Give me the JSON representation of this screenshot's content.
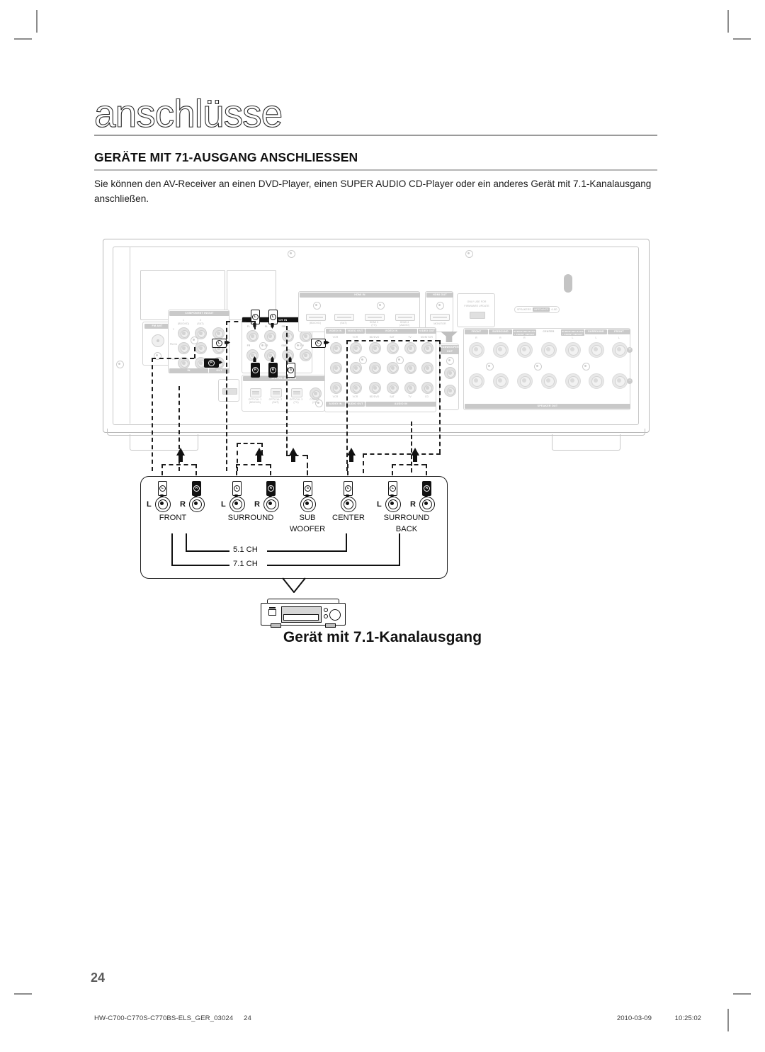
{
  "document": {
    "chapter_title": "anschlüsse",
    "section_title": "GERÄTE MIT 71-AUSGANG ANSCHLIESSEN",
    "intro_text": "Sie können den AV-Receiver an einen DVD-Player, einen SUPER AUDIO CD-Player oder ein anderes Gerät mit 7.1-Kanalausgang anschließen.",
    "page_number": "24",
    "caption": "Gerät mit 7.1-Kanalausgang"
  },
  "footer": {
    "file_id": "HW-C700-C770S-C770BS-ELS_GER_03024",
    "page": "24",
    "date": "2010-03-09",
    "time": "10:25:02"
  },
  "receiver": {
    "component": {
      "header": "COMPONENT IN/OUT",
      "col1_num": "1",
      "col1_name": "(BD/DVD)",
      "col2_num": "2",
      "col2_name": "(SAT)",
      "row_y": "Y",
      "row_pb": "Pb/Cb",
      "row_pr": "Pr/Cr",
      "foot_in": "IN",
      "foot_out": "OUT"
    },
    "fm_ant": "FM ANT",
    "multi_ch": {
      "header": "MULTI CH IN",
      "top": [
        "FL",
        "SL",
        "SBL",
        "CEN"
      ],
      "bottom": [
        "FR",
        "SR",
        "SBR",
        "SW"
      ]
    },
    "hdmi_in": {
      "header": "HDMI IN",
      "ports": [
        "(BD/DVD)",
        "(SAT)",
        "HDMI 3\n(TV)",
        "HDMI 4\n(AUDIO)"
      ]
    },
    "hdmi_out": {
      "header": "HDMI OUT",
      "port": "MONITOR"
    },
    "firmware": {
      "line1": "ONLY USE FOR",
      "line2": "FIRMWARE UPDATE"
    },
    "impedance": {
      "prefix": "SPEAKERS",
      "badge": "IMPEDANCE",
      "value": "6-8Ω"
    },
    "digital_audio": {
      "header": "DIGITAL AUDIO IN",
      "ports": [
        {
          "name": "OPTICAL 1",
          "sub": "(BD/DVD)"
        },
        {
          "name": "OPTICAL 2",
          "sub": "(SAT)"
        },
        {
          "name": "OPTICAL 3",
          "sub": "(TV)"
        },
        {
          "name": "COAXIAL",
          "sub": "(CD)"
        }
      ]
    },
    "video": {
      "hdr_video_in_1": "VIDEO IN",
      "hdr_video_out_1": "VIDEO OUT",
      "hdr_video_in_2": "VIDEO IN",
      "hdr_video_out_2": "VIDEO OUT",
      "top_labels": [
        "VCR",
        "VCR",
        "BD/DVD",
        "SAT",
        "TV",
        "MONITOR"
      ],
      "bottom_labels": [
        "VCR",
        "VCR",
        "BD/DVD",
        "SAT",
        "TV",
        "CD"
      ],
      "hdr_audio_in_1": "AUDIO IN",
      "hdr_audio_out": "AUDIO OUT",
      "hdr_audio_in_2": "AUDIO IN"
    },
    "subwoofer_out": "SUBWOOFER\nOUT",
    "speaker_out": {
      "footer": "SPEAKER OUT",
      "terminals": [
        {
          "name": "FRONT",
          "ch": "R"
        },
        {
          "name": "SURROUND",
          "ch": "R"
        },
        {
          "name": "SURROUND BACK\n/ FRONT HEIGHT",
          "ch": "R"
        },
        {
          "name": "CENTER",
          "ch": ""
        },
        {
          "name": "SURROUND BACK\n/ FRONT HEIGHT",
          "ch": "L"
        },
        {
          "name": "SURROUND",
          "ch": "L"
        },
        {
          "name": "FRONT",
          "ch": "L"
        }
      ],
      "plus": "+",
      "minus": "−"
    }
  },
  "device_panel": {
    "jacks": [
      {
        "label": "FRONT",
        "lr": "L",
        "plug": "white",
        "ring": "L"
      },
      {
        "label": "",
        "lr": "R",
        "plug": "black",
        "ring": "R"
      },
      {
        "label": "SURROUND",
        "lr": "L",
        "plug": "white",
        "ring": "L"
      },
      {
        "label": "",
        "lr": "R",
        "plug": "black",
        "ring": "R"
      },
      {
        "label": "SUB\nWOOFER",
        "lr": "",
        "plug": "white",
        "ring": "S"
      },
      {
        "label": "CENTER",
        "lr": "",
        "plug": "white",
        "ring": "C"
      },
      {
        "label": "SURROUND\nBACK",
        "lr": "L",
        "plug": "white",
        "ring": "L"
      },
      {
        "label": "",
        "lr": "R",
        "plug": "black",
        "ring": "R"
      }
    ],
    "labels": {
      "front": "FRONT",
      "surround": "SURROUND",
      "sub": "SUB",
      "woofer": "WOOFER",
      "center": "CENTER",
      "surround_back_1": "SURROUND",
      "surround_back_2": "BACK"
    },
    "ch_51": "5.1 CH",
    "ch_71": "7.1 CH"
  }
}
